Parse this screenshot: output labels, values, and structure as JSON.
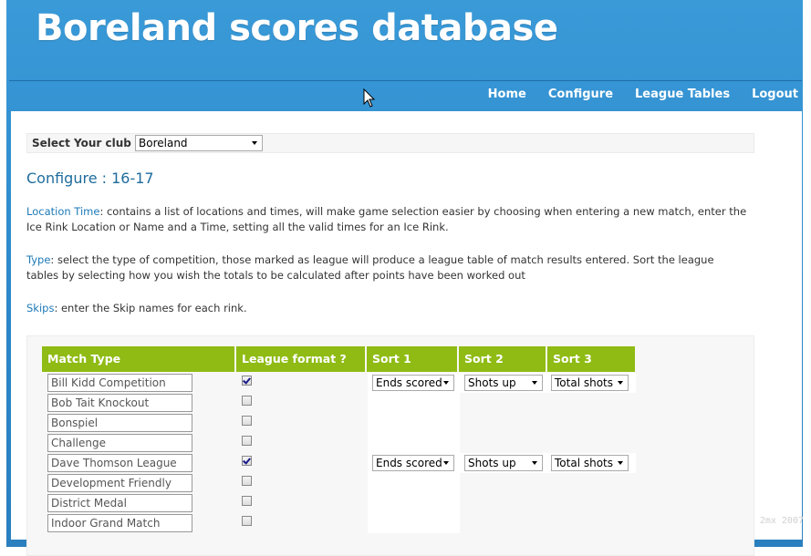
{
  "site": {
    "title": "Boreland scores database"
  },
  "nav": {
    "items": [
      "Home",
      "Configure",
      "League Tables",
      "Logout"
    ]
  },
  "club_selector": {
    "label": "Select Your club :",
    "value": "Boreland"
  },
  "page": {
    "heading": "Configure : 16-17"
  },
  "descriptions": [
    {
      "term": "Location Time",
      "text": ": contains a list of locations and times, will make game selection easier by choosing when entering a new match, enter the Ice Rink Location or Name and a Time, setting all the valid times for an Ice Rink."
    },
    {
      "term": "Type",
      "text": ": select the type of competition, those marked as league will produce a league table of match results entered. Sort the league tables by selecting how you wish the totals to be calculated after points have been worked out"
    },
    {
      "term": "Skips",
      "text": ": enter the Skip names for each rink."
    }
  ],
  "table": {
    "headers": [
      "Match Type",
      "League format ?",
      "Sort 1",
      "Sort 2",
      "Sort 3"
    ],
    "rows": [
      {
        "match_type": "Bill Kidd Competition",
        "league": true,
        "sort1": "Ends scored",
        "sort2": "Shots up",
        "sort3": "Total shots"
      },
      {
        "match_type": "Bob Tait Knockout",
        "league": false
      },
      {
        "match_type": "Bonspiel",
        "league": false
      },
      {
        "match_type": "Challenge",
        "league": false
      },
      {
        "match_type": "Dave Thomson League",
        "league": true,
        "sort1": "Ends scored",
        "sort2": "Shots up",
        "sort3": "Total shots"
      },
      {
        "match_type": "Development Friendly",
        "league": false
      },
      {
        "match_type": "District Medal",
        "league": false
      },
      {
        "match_type": "Indoor Grand Match",
        "league": false
      }
    ]
  },
  "watermark": "2mx 2007"
}
